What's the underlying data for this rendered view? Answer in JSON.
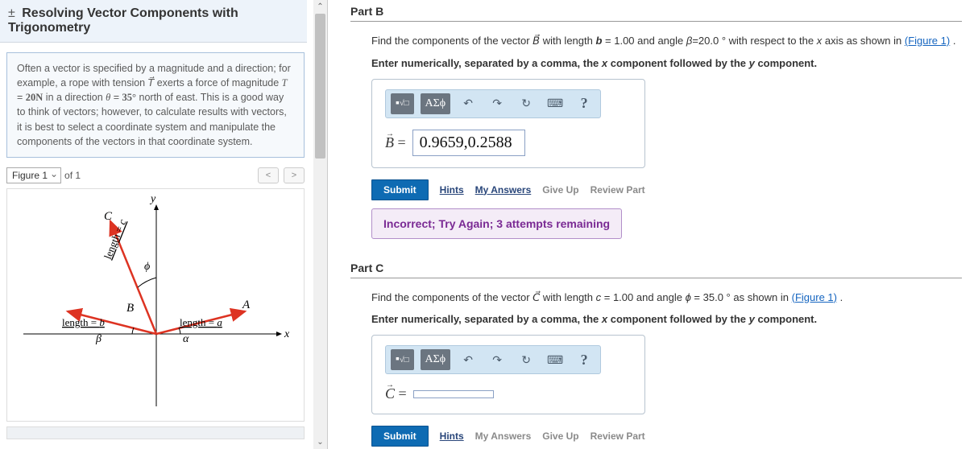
{
  "left": {
    "title": "Resolving Vector Components with Trigonometry",
    "info_html": "Often a vector is specified by a magnitude and a direction; for example, a rope with tension <i>T⃗</i> exerts a force of magnitude <i>T</i> = <b>20N</b> in a direction <i>θ</i> = <b>35°</b> north of east. This is a good way to think of vectors; however, to calculate results with vectors, it is best to select a coordinate system and manipulate the components of the vectors in that coordinate system.",
    "figure_label": "Figure 1",
    "figure_count": "of 1"
  },
  "partB": {
    "header": "Part B",
    "prompt": "Find the components of the vector B⃗ with length b = 1.00 and angle β=20.0 ° with respect to the x axis as shown in",
    "fig_link": "(Figure 1)",
    "instruction": "Enter numerically, separated by a comma, the x component followed by the y component.",
    "lhs": "B⃗ =",
    "value": "0.9659,0.2588",
    "feedback": "Incorrect; Try Again; 3 attempts remaining"
  },
  "partC": {
    "header": "Part C",
    "prompt": "Find the components of the vector C⃗ with length c = 1.00 and angle ϕ = 35.0 ° as shown in",
    "fig_link": "(Figure 1)",
    "instruction": "Enter numerically, separated by a comma, the x component followed by the y component.",
    "lhs": "C⃗ =",
    "value": ""
  },
  "actions": {
    "submit": "Submit",
    "hints": "Hints",
    "my_answers": "My Answers",
    "give_up": "Give Up",
    "review": "Review Part"
  },
  "toolbar": {
    "greek": "ΑΣϕ",
    "help": "?"
  }
}
